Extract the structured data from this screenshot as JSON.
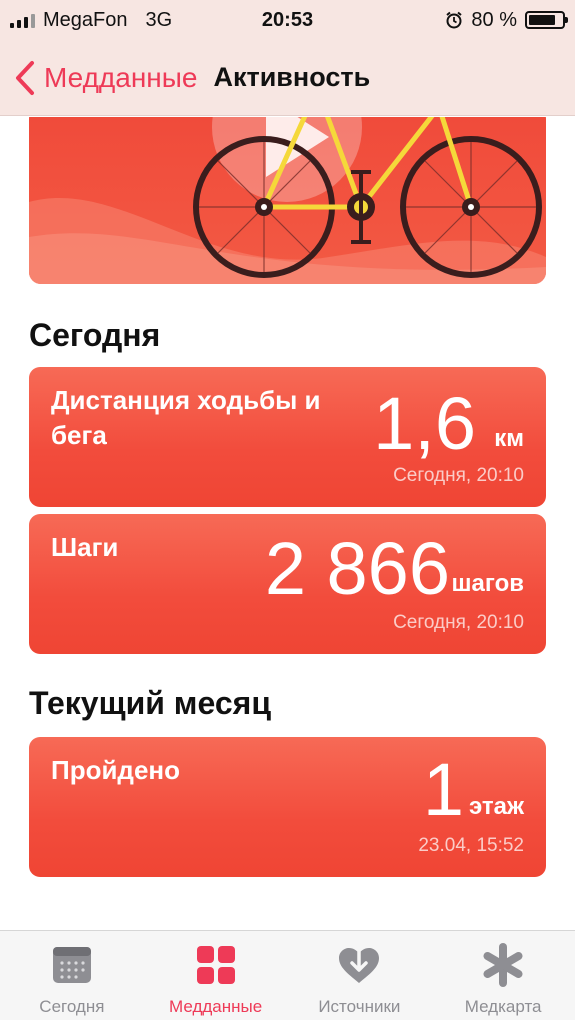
{
  "status_bar": {
    "carrier": "MegaFon",
    "network": "3G",
    "time": "20:53",
    "battery_text": "80 %",
    "battery_level": 0.8
  },
  "nav": {
    "back_label": "Медданные",
    "title": "Активность"
  },
  "sections": {
    "today_title": "Сегодня",
    "month_title": "Текущий месяц"
  },
  "cards": {
    "distance": {
      "label": "Дистанция ходьбы и бега",
      "value": "1,6",
      "unit": "км",
      "date": "Сегодня, 20:10"
    },
    "steps": {
      "label": "Шаги",
      "value": "2 866",
      "unit": "шагов",
      "date": "Сегодня, 20:10"
    },
    "floors": {
      "label": "Пройдено",
      "value": "1",
      "unit": "этаж",
      "date": "23.04, 15:52"
    }
  },
  "tabs": [
    {
      "label": "Сегодня",
      "icon": "calendar-icon"
    },
    {
      "label": "Медданные",
      "icon": "grid-icon"
    },
    {
      "label": "Источники",
      "icon": "heart-download-icon"
    },
    {
      "label": "Медкарта",
      "icon": "asterisk-icon"
    }
  ],
  "colors": {
    "accent": "#ee3a57",
    "card_red": "#f24c3c"
  }
}
